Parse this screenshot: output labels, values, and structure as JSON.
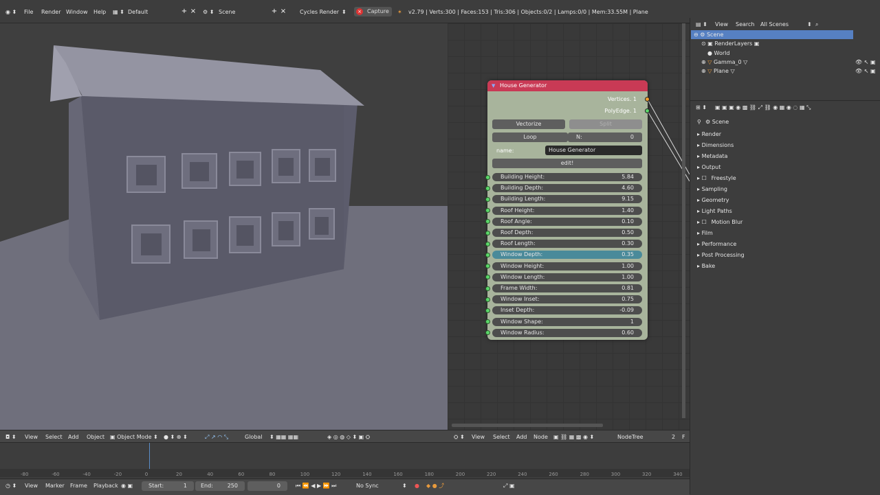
{
  "menu": {
    "items": [
      "File",
      "Render",
      "Window",
      "Help"
    ],
    "layout": "Default",
    "scene": "Scene",
    "engine": "Cycles Render",
    "capture": "Capture",
    "stats": "v2.79 | Verts:300 | Faces:153 | Tris:306 | Objects:0/2 | Lamps:0/0 | Mem:33.55M | Plane"
  },
  "node": {
    "title": "House Generator",
    "outputs": [
      "Vertices. 1",
      "PolyEdge. 1"
    ],
    "vectorize": "Vectorize",
    "split": "Split",
    "loop": "Loop",
    "n_label": "N:",
    "n_value": "0",
    "name_label": "name:",
    "name_value": "House Generator",
    "edit": "edit!",
    "fields": [
      {
        "label": "Building Height:",
        "value": "5.84"
      },
      {
        "label": "Building Depth:",
        "value": "4.60"
      },
      {
        "label": "Building Length:",
        "value": "9.15"
      },
      {
        "label": "Roof Height:",
        "value": "1.40"
      },
      {
        "label": "Roof Angle:",
        "value": "0.10"
      },
      {
        "label": "Roof Depth:",
        "value": "0.50"
      },
      {
        "label": "Roof Length:",
        "value": "0.30"
      },
      {
        "label": "Window Depth:",
        "value": "0.35"
      },
      {
        "label": "Window Height:",
        "value": "1.00"
      },
      {
        "label": "Window Length:",
        "value": "1.00"
      },
      {
        "label": "Frame Width:",
        "value": "0.81"
      },
      {
        "label": "Window Inset:",
        "value": "0.75"
      },
      {
        "label": "Inset Depth:",
        "value": "-0.09"
      },
      {
        "label": "Window Shape:",
        "value": "1"
      },
      {
        "label": "Window Radius:",
        "value": "0.60"
      }
    ],
    "highlight_index": 7
  },
  "outliner": {
    "view": "View",
    "search": "Search",
    "all_scenes": "All Scenes",
    "rows": [
      "Scene",
      "RenderLayers",
      "World",
      "Gamma_0",
      "Plane"
    ]
  },
  "properties": {
    "context": "Scene",
    "panels": [
      "Render",
      "Dimensions",
      "Metadata",
      "Output",
      "Freestyle",
      "Sampling",
      "Geometry",
      "Light Paths",
      "Motion Blur",
      "Film",
      "Performance",
      "Post Processing",
      "Bake"
    ]
  },
  "viewhdr": {
    "view": "View",
    "select": "Select",
    "add": "Add",
    "object": "Object",
    "mode": "Object Mode",
    "orient": "Global"
  },
  "nodehdr": {
    "view": "View",
    "select": "Select",
    "add": "Add",
    "node": "Node",
    "tree": "NodeTree",
    "users": "2",
    "fake": "F"
  },
  "timeline": {
    "view": "View",
    "marker": "Marker",
    "frame": "Frame",
    "playback": "Playback",
    "start_label": "Start:",
    "start": "1",
    "end_label": "End:",
    "end": "250",
    "current": "0",
    "sync": "No Sync",
    "ruler": [
      "-80",
      "-60",
      "-40",
      "-20",
      "0",
      "20",
      "40",
      "60",
      "80",
      "100",
      "120",
      "140",
      "160",
      "180",
      "200",
      "220",
      "240",
      "260",
      "280",
      "300",
      "320",
      "340"
    ]
  }
}
